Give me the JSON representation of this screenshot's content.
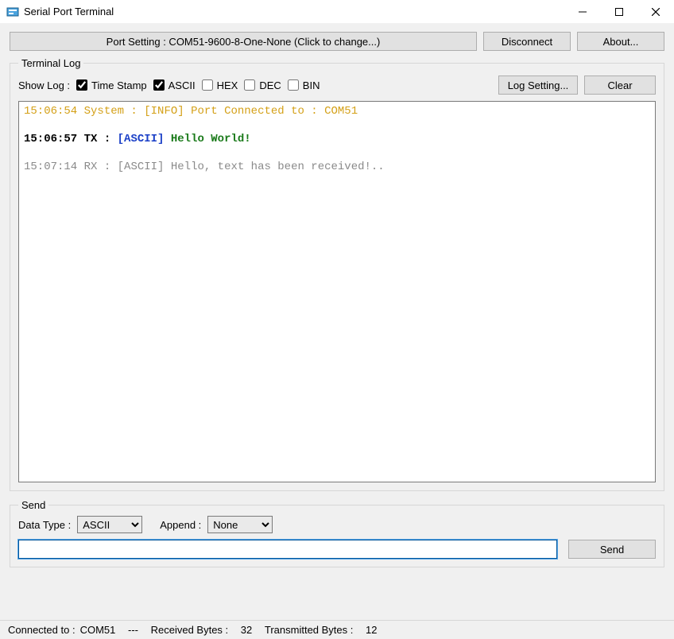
{
  "window": {
    "title": "Serial Port Terminal"
  },
  "toolbar": {
    "port_setting_label": "Port Setting : COM51-9600-8-One-None (Click to change...)",
    "disconnect_label": "Disconnect",
    "about_label": "About..."
  },
  "terminal_log": {
    "legend": "Terminal Log",
    "show_log_label": "Show Log :",
    "checkboxes": {
      "timestamp": {
        "label": "Time Stamp",
        "checked": true
      },
      "ascii": {
        "label": "ASCII",
        "checked": true
      },
      "hex": {
        "label": "HEX",
        "checked": false
      },
      "dec": {
        "label": "DEC",
        "checked": false
      },
      "bin": {
        "label": "BIN",
        "checked": false
      }
    },
    "log_setting_label": "Log Setting...",
    "clear_label": "Clear",
    "lines": [
      {
        "kind": "sys",
        "ts": "15:06:54",
        "src": "System",
        "tag": "[INFO]",
        "msg": "Port Connected to : COM51"
      },
      {
        "kind": "tx",
        "ts": "15:06:57",
        "src": "TX",
        "tag": "[ASCII]",
        "msg": "Hello World!"
      },
      {
        "kind": "rx",
        "ts": "15:07:14",
        "src": "RX",
        "tag": "[ASCII]",
        "msg": "Hello, text has been received!.."
      }
    ]
  },
  "send": {
    "legend": "Send",
    "data_type_label": "Data Type :",
    "data_type_value": "ASCII",
    "append_label": "Append :",
    "append_value": "None",
    "input_value": "",
    "send_button_label": "Send"
  },
  "status": {
    "connected_label": "Connected to :",
    "connected_value": "COM51",
    "separator": "---",
    "received_label": "Received Bytes :",
    "received_value": "32",
    "transmitted_label": "Transmitted Bytes :",
    "transmitted_value": "12"
  }
}
